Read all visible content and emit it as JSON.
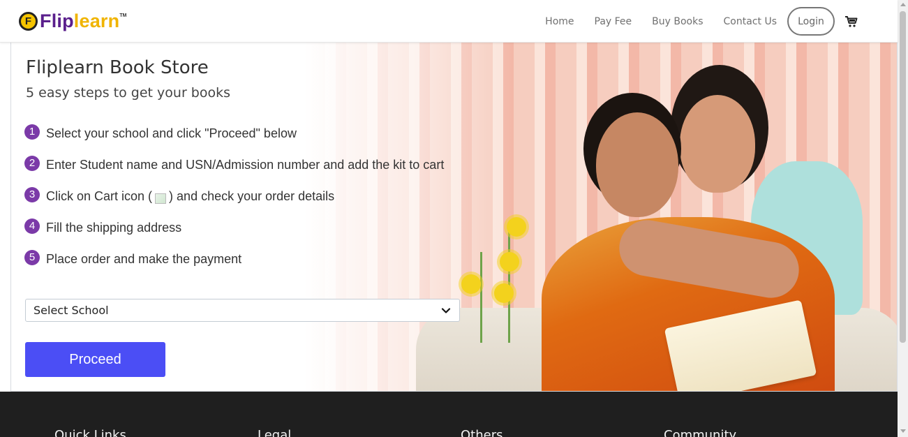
{
  "header": {
    "logo": {
      "part1": "Flip",
      "part2": "learn",
      "tm": "TM",
      "badge": "F"
    },
    "nav": [
      {
        "label": "Home"
      },
      {
        "label": "Pay Fee"
      },
      {
        "label": "Buy Books"
      },
      {
        "label": "Contact Us"
      }
    ],
    "login_label": "Login",
    "cart_icon": "cart-icon"
  },
  "hero": {
    "title": "Fliplearn Book Store",
    "subtitle": "5 easy steps to get your books",
    "steps": [
      {
        "num": "1",
        "text": "Select your school and click \"Proceed\" below"
      },
      {
        "num": "2",
        "text": "Enter Student name and USN/Admission number and add the kit to cart"
      },
      {
        "num": "3",
        "text_before": "Click on Cart icon (",
        "text_after": ") and check your order details"
      },
      {
        "num": "4",
        "text": "Fill the shipping address"
      },
      {
        "num": "5",
        "text": "Place order and make the payment"
      }
    ],
    "select_school": {
      "value": "Select School"
    },
    "proceed_label": "Proceed"
  },
  "footer": {
    "columns": [
      {
        "label": "Quick Links"
      },
      {
        "label": "Legal"
      },
      {
        "label": "Others"
      },
      {
        "label": "Community"
      }
    ]
  },
  "colors": {
    "brand_purple": "#5a1f8c",
    "brand_yellow": "#f0b400",
    "step_badge": "#7b3aa8",
    "proceed_button": "#4b4ef5",
    "footer_bg": "#1f1f1f"
  }
}
